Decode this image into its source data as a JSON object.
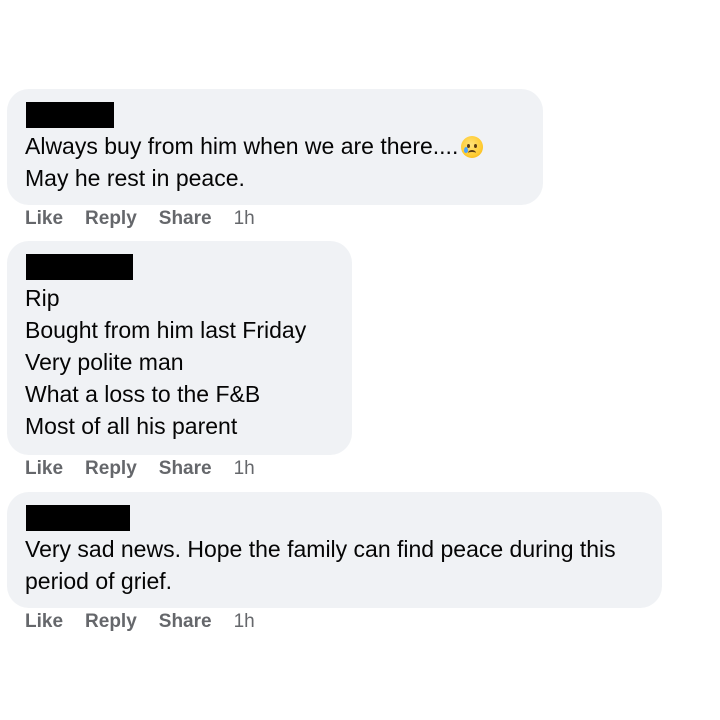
{
  "comments": [
    {
      "lines": [
        "Always buy from him when we are there....",
        "May he rest in peace."
      ],
      "emoji": "crying-face-icon",
      "actions": {
        "like": "Like",
        "reply": "Reply",
        "share": "Share",
        "time": "1h"
      }
    },
    {
      "lines": [
        "Rip",
        "Bought from him last Friday",
        "Very polite man",
        "What a loss to the F&B",
        "Most of all his parent"
      ],
      "actions": {
        "like": "Like",
        "reply": "Reply",
        "share": "Share",
        "time": "1h"
      }
    },
    {
      "lines": [
        "Very sad news. Hope the family can find peace during this period of grief."
      ],
      "actions": {
        "like": "Like",
        "reply": "Reply",
        "share": "Share",
        "time": "1h"
      }
    }
  ],
  "colors": {
    "bubble": "#f0f2f5",
    "text": "#050505",
    "meta": "#65676b",
    "redaction": "#000000"
  }
}
